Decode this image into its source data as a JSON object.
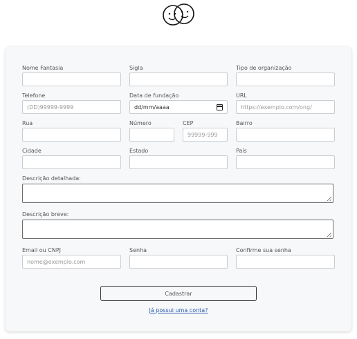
{
  "logo": {
    "icon": "two-faces-logo-icon"
  },
  "form": {
    "nome_fantasia": {
      "label": "Nome Fantasia",
      "value": "",
      "placeholder": ""
    },
    "sigla": {
      "label": "Sigla",
      "value": "",
      "placeholder": ""
    },
    "tipo": {
      "label": "Tipo de organização",
      "value": "",
      "placeholder": ""
    },
    "telefone": {
      "label": "Telefone",
      "placeholder": "(DD)99999-9999"
    },
    "data_fundacao": {
      "label": "Data de fundação",
      "value": "dd/mm/aaaa",
      "icon": "calendar-icon"
    },
    "url": {
      "label": "URL",
      "placeholder": "https://exemplo.com/ong/"
    },
    "rua": {
      "label": "Rua",
      "placeholder": ""
    },
    "numero": {
      "label": "Número",
      "placeholder": ""
    },
    "cep": {
      "label": "CEP",
      "placeholder": "99999-999"
    },
    "bairro": {
      "label": "Bairro",
      "placeholder": ""
    },
    "cidade": {
      "label": "Cidade",
      "placeholder": ""
    },
    "estado": {
      "label": "Estado",
      "placeholder": ""
    },
    "pais": {
      "label": "País",
      "placeholder": ""
    },
    "descricao_detalhada": {
      "label": "Descrição detalhada:"
    },
    "descricao_breve": {
      "label": "Descrição breve:"
    },
    "email": {
      "label": "Email ou CNPJ",
      "placeholder": "nome@exemplo.com"
    },
    "senha": {
      "label": "Senha",
      "placeholder": ""
    },
    "confirme": {
      "label": "Confirme sua senha",
      "placeholder": ""
    },
    "submit_label": "Cadastrar",
    "login_link": "Já possui uma conta?"
  }
}
